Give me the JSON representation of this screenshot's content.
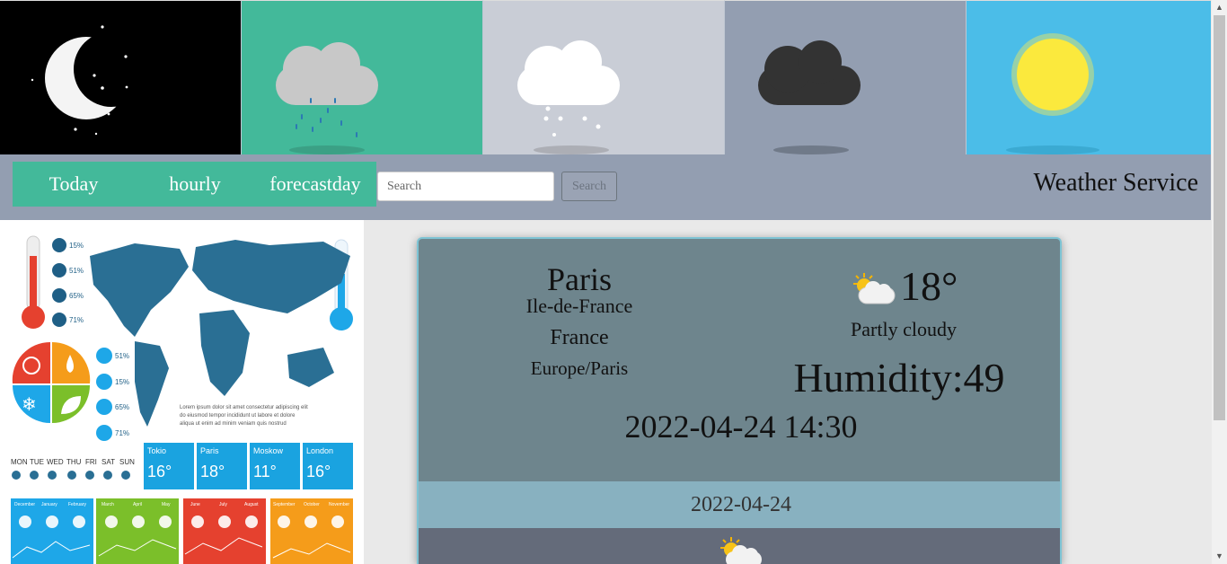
{
  "banner": {
    "tiles": [
      {
        "name": "night",
        "icon": "moon-stars-icon"
      },
      {
        "name": "rain",
        "icon": "rain-cloud-icon"
      },
      {
        "name": "snow",
        "icon": "snow-cloud-icon"
      },
      {
        "name": "overcast",
        "icon": "dark-cloud-icon"
      },
      {
        "name": "sunny",
        "icon": "sun-icon"
      }
    ]
  },
  "nav": {
    "tabs": [
      {
        "label": "Today"
      },
      {
        "label": "hourly"
      },
      {
        "label": "forecastday"
      }
    ],
    "search_placeholder": "Search",
    "search_button": "Search",
    "brand": "Weather Service",
    "accent": "#43b99a",
    "bar_color": "#939eb1"
  },
  "weather": {
    "city": "Paris",
    "region": "Ile-de-France",
    "country": "France",
    "timezone": "Europe/Paris",
    "temperature": "18°",
    "condition": "Partly cloudy",
    "condition_icon": "partly-cloudy-icon",
    "humidity": "Humidity:49",
    "local_time": "2022-04-24 14:30"
  },
  "forecast": {
    "date": "2022-04-24",
    "icon": "partly-cloudy-icon"
  },
  "infographic": {
    "percent_labels": [
      "15%",
      "51%",
      "65%",
      "71%"
    ],
    "side_labels": [
      "51%",
      "15%",
      "65%",
      "71%"
    ],
    "weekdays": [
      "MON",
      "TUE",
      "WED",
      "THU",
      "FRI",
      "SAT",
      "SUN"
    ],
    "city_cards": [
      {
        "city": "Tokio",
        "temp": "16°",
        "color": "#1aa3e0"
      },
      {
        "city": "Paris",
        "temp": "18°",
        "color": "#1aa3e0"
      },
      {
        "city": "Moskow",
        "temp": "11°",
        "color": "#1aa3e0"
      },
      {
        "city": "London",
        "temp": "16°",
        "color": "#1aa3e0"
      }
    ],
    "months": [
      "December",
      "January",
      "February",
      "March",
      "April",
      "May",
      "June",
      "July",
      "August",
      "September",
      "October",
      "November"
    ]
  }
}
